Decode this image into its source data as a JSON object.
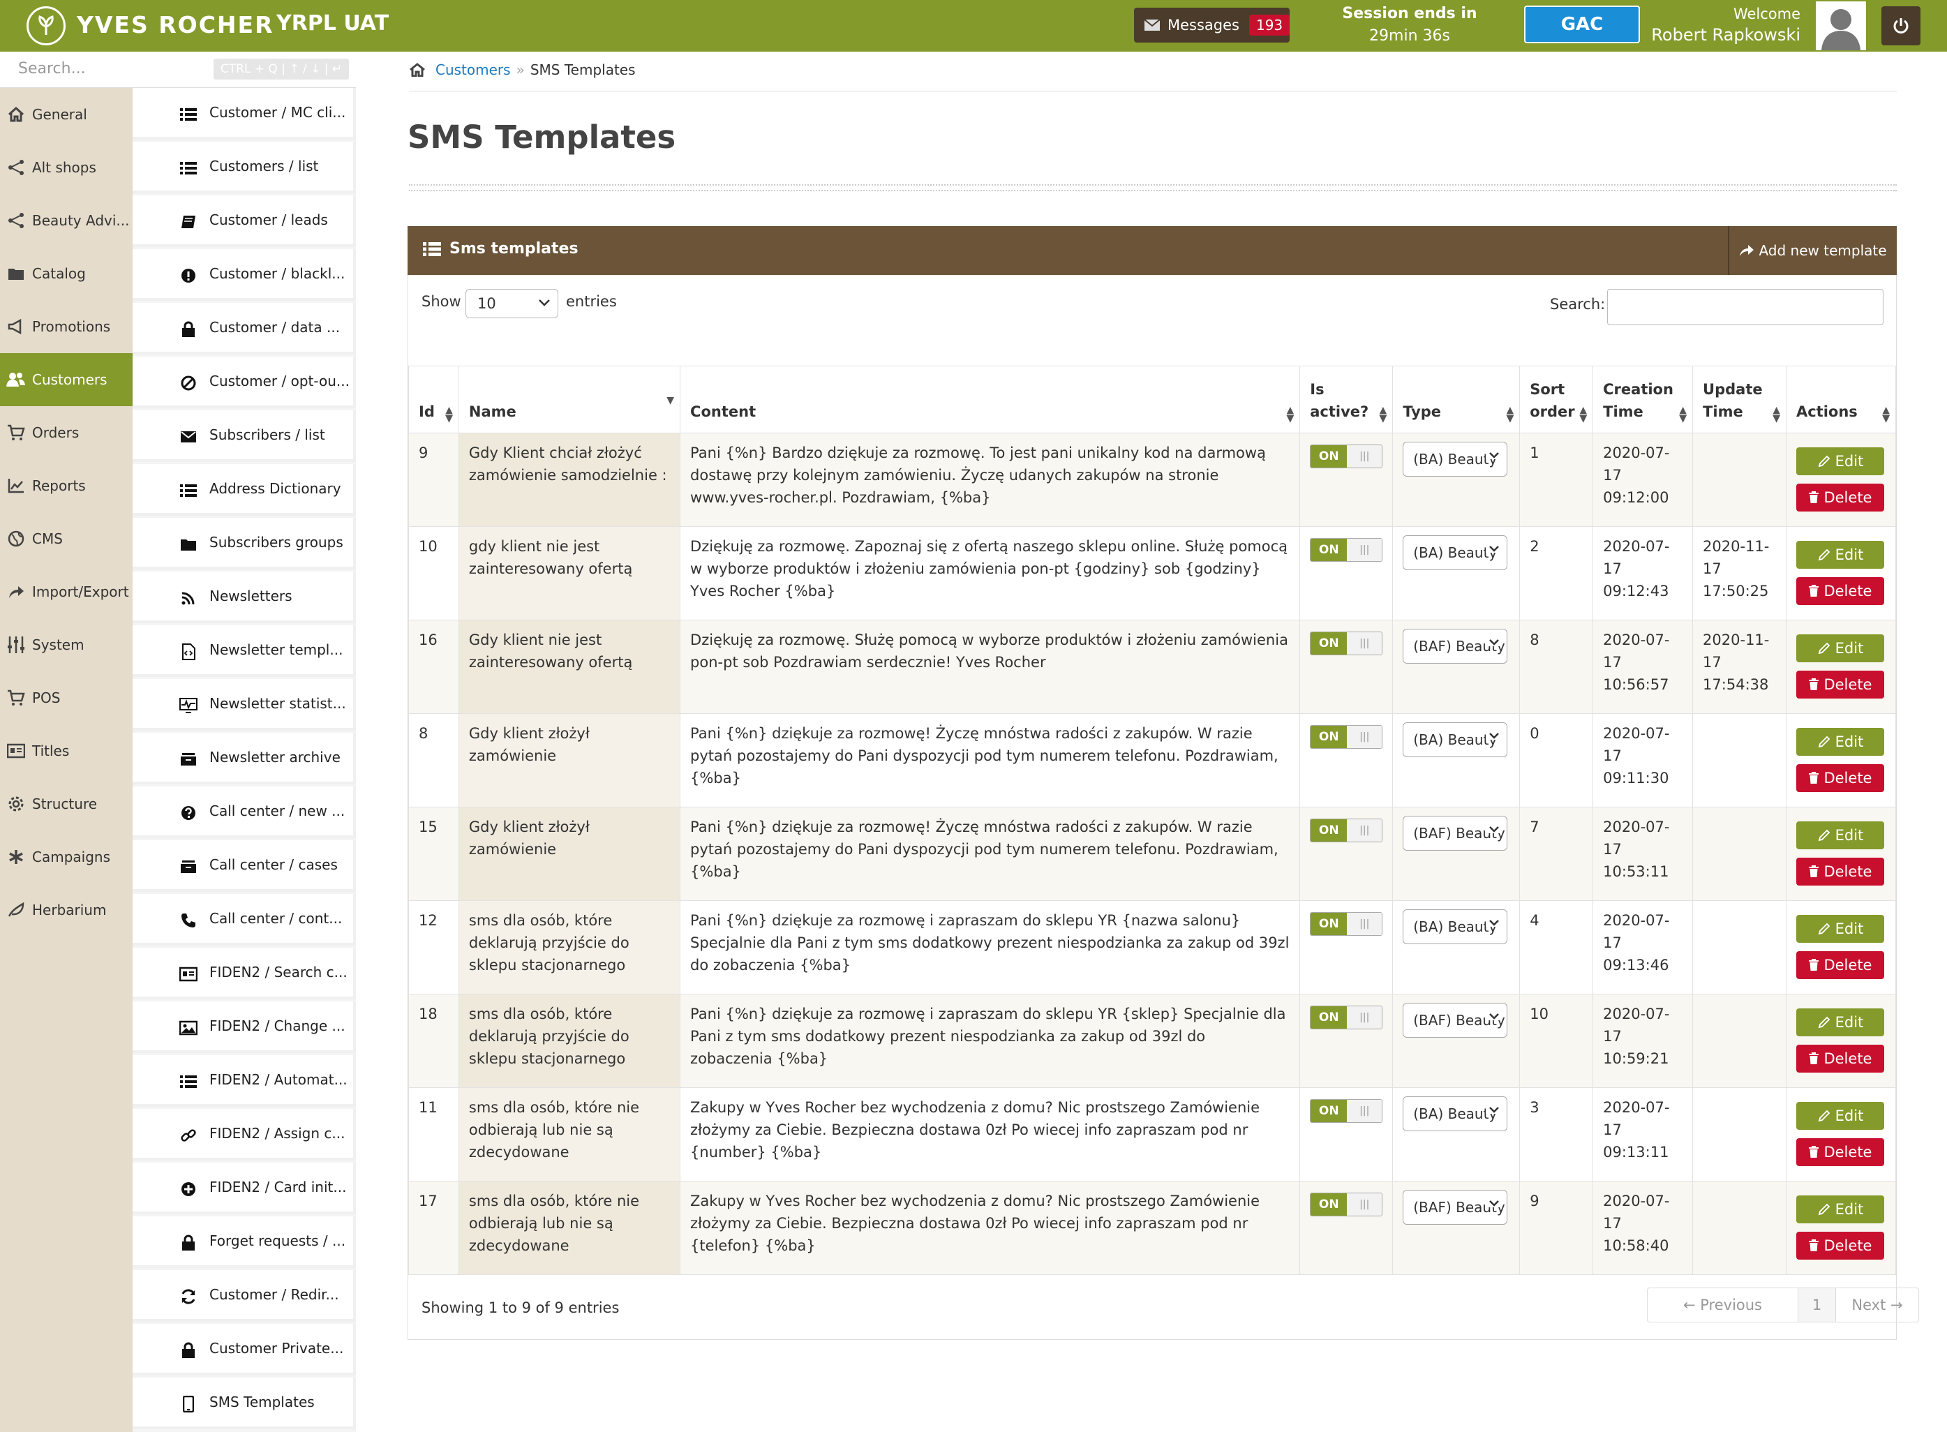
{
  "header": {
    "brand": "YVES ROCHER",
    "env": "YRPL UAT",
    "messages_label": "Messages",
    "messages_count": "193",
    "session_label": "Session ends in",
    "session_time": "29min 36s",
    "gac_label": "GAC",
    "welcome_label": "Welcome",
    "user_name": "Robert Rapkowski"
  },
  "sidebar": {
    "search_placeholder": "Search...",
    "search_hint": "CTRL + Q | ↑ / ↓ | ↵",
    "main_items": [
      {
        "label": "General",
        "icon": "home-icon"
      },
      {
        "label": "Alt shops",
        "icon": "share-icon"
      },
      {
        "label": "Beauty Advi...",
        "icon": "share-icon"
      },
      {
        "label": "Catalog",
        "icon": "folder-icon"
      },
      {
        "label": "Promotions",
        "icon": "bullhorn-icon"
      },
      {
        "label": "Customers",
        "icon": "users-icon"
      },
      {
        "label": "Orders",
        "icon": "cart-icon"
      },
      {
        "label": "Reports",
        "icon": "chart-icon"
      },
      {
        "label": "CMS",
        "icon": "globe-icon"
      },
      {
        "label": "Import/Export",
        "icon": "share-arrow-icon"
      },
      {
        "label": "System",
        "icon": "sliders-icon"
      },
      {
        "label": "POS",
        "icon": "cart-icon"
      },
      {
        "label": "Titles",
        "icon": "id-card-icon"
      },
      {
        "label": "Structure",
        "icon": "gear-icon"
      },
      {
        "label": "Campaigns",
        "icon": "asterisk-icon"
      },
      {
        "label": "Herbarium",
        "icon": "leaf-icon"
      }
    ],
    "sub_items": [
      {
        "label": "Customer / MC cli...",
        "icon": "list-icon"
      },
      {
        "label": "Customers / list",
        "icon": "list-icon"
      },
      {
        "label": "Customer / leads",
        "icon": "book-icon"
      },
      {
        "label": "Customer / blackl...",
        "icon": "exclamation-icon"
      },
      {
        "label": "Customer / data ...",
        "icon": "lock-icon"
      },
      {
        "label": "Customer / opt-ou...",
        "icon": "ban-icon"
      },
      {
        "label": "Subscribers / list",
        "icon": "envelope-icon"
      },
      {
        "label": "Address Dictionary",
        "icon": "list-icon"
      },
      {
        "label": "Subscribers groups",
        "icon": "folder-icon"
      },
      {
        "label": "Newsletters",
        "icon": "rss-icon"
      },
      {
        "label": "Newsletter templ...",
        "icon": "file-code-icon"
      },
      {
        "label": "Newsletter statist...",
        "icon": "heartbeat-icon"
      },
      {
        "label": "Newsletter archive",
        "icon": "inbox-icon"
      },
      {
        "label": "Call center / new ...",
        "icon": "question-icon"
      },
      {
        "label": "Call center / cases",
        "icon": "inbox-icon"
      },
      {
        "label": "Call center / cont...",
        "icon": "phone-icon"
      },
      {
        "label": "FIDEN2 / Search c...",
        "icon": "id-card-icon"
      },
      {
        "label": "FIDEN2 / Change ...",
        "icon": "image-icon"
      },
      {
        "label": "FIDEN2 / Automat...",
        "icon": "list-icon"
      },
      {
        "label": "FIDEN2 / Assign c...",
        "icon": "link-icon"
      },
      {
        "label": "FIDEN2 / Card init...",
        "icon": "plus-circle-icon"
      },
      {
        "label": "Forget requests / ...",
        "icon": "lock-icon"
      },
      {
        "label": "Customer / Redir...",
        "icon": "refresh-icon"
      },
      {
        "label": "Customer Private...",
        "icon": "lock-icon"
      },
      {
        "label": "SMS Templates",
        "icon": "mobile-icon"
      }
    ]
  },
  "breadcrumb": {
    "parent": "Customers",
    "sep": "»",
    "current": "SMS Templates"
  },
  "page": {
    "title": "SMS Templates"
  },
  "panel": {
    "title": "Sms templates",
    "add_label": "Add new template",
    "show_label": "Show",
    "page_size": "10",
    "entries_label": "entries",
    "search_label": "Search:",
    "showing_text": "Showing 1 to 9 of 9 entries",
    "pager": {
      "prev": "← Previous",
      "page": "1",
      "next": "Next →"
    }
  },
  "table": {
    "columns": {
      "id": "Id",
      "name": "Name",
      "content": "Content",
      "is_active_1": "Is",
      "is_active_2": "active?",
      "type": "Type",
      "sort_1": "Sort",
      "sort_2": "order",
      "creation_1": "Creation",
      "creation_2": "Time",
      "update_1": "Update",
      "update_2": "Time",
      "actions": "Actions"
    },
    "on_label": "ON",
    "edit_label": "Edit",
    "delete_label": "Delete",
    "rows": [
      {
        "id": "9",
        "name": "Gdy Klient chciał złożyć zamówienie samodzielnie :",
        "content": "Pani {%n} Bardzo dziękuje za rozmowę. To jest pani unikalny kod na darmową dostawę przy kolejnym zamówieniu. Życzę udanych zakupów na stronie www.yves-rocher.pl. Pozdrawiam, {%ba}",
        "type": "(BA) Beauty",
        "sort": "1",
        "created_date": "2020-07-17",
        "created_time": "09:12:00",
        "updated": ""
      },
      {
        "id": "10",
        "name": "gdy klient nie jest zainteresowany ofertą",
        "content": "Dziękuję za rozmowę. Zapoznaj się z ofertą naszego sklepu online. Służę pomocą w wyborze produktów i złożeniu zamówienia pon-pt {godziny} sob {godziny} Yves Rocher {%ba}",
        "type": "(BA) Beauty",
        "sort": "2",
        "created_date": "2020-07-17",
        "created_time": "09:12:43",
        "updated": "2020-11-17 17:50:25"
      },
      {
        "id": "16",
        "name": "Gdy klient nie jest zainteresowany ofertą",
        "content": "Dziękuję za rozmowę. Służę pomocą w wyborze produktów i złożeniu zamówienia pon-pt sob Pozdrawiam serdecznie! Yves Rocher",
        "type": "(BAF) Beauty",
        "sort": "8",
        "created_date": "2020-07-17",
        "created_time": "10:56:57",
        "updated": "2020-11-17 17:54:38"
      },
      {
        "id": "8",
        "name": "Gdy klient złożył zamówienie",
        "content": "Pani {%n} dziękuje za rozmowę! Życzę mnóstwa radości z zakupów. W razie pytań pozostajemy do Pani dyspozycji pod tym numerem telefonu. Pozdrawiam, {%ba}",
        "type": "(BA) Beauty",
        "sort": "0",
        "created_date": "2020-07-17",
        "created_time": "09:11:30",
        "updated": ""
      },
      {
        "id": "15",
        "name": "Gdy klient złożył zamówienie",
        "content": "Pani {%n} dziękuje za rozmowę! Życzę mnóstwa radości z zakupów. W razie pytań pozostajemy do Pani dyspozycji pod tym numerem telefonu. Pozdrawiam, {%ba}",
        "type": "(BAF) Beauty",
        "sort": "7",
        "created_date": "2020-07-17",
        "created_time": "10:53:11",
        "updated": ""
      },
      {
        "id": "12",
        "name": "sms dla osób, które deklarują przyjście do sklepu stacjonarnego",
        "content": "Pani {%n} dziękuje za rozmowę i zapraszam do sklepu YR {nazwa salonu} Specjalnie dla Pani z tym sms dodatkowy prezent niespodzianka za zakup od 39zl do zobaczenia {%ba}",
        "type": "(BA) Beauty",
        "sort": "4",
        "created_date": "2020-07-17",
        "created_time": "09:13:46",
        "updated": ""
      },
      {
        "id": "18",
        "name": "sms dla osób, które deklarują przyjście do sklepu stacjonarnego",
        "content": "Pani {%n} dziękuje za rozmowę i zapraszam do sklepu YR {sklep} Specjalnie dla Pani z tym sms dodatkowy prezent niespodzianka za zakup od 39zl do zobaczenia {%ba}",
        "type": "(BAF) Beauty",
        "sort": "10",
        "created_date": "2020-07-17",
        "created_time": "10:59:21",
        "updated": ""
      },
      {
        "id": "11",
        "name": "sms dla osób, które nie odbierają lub nie są zdecydowane",
        "content": "Zakupy w Yves Rocher bez wychodzenia z domu? Nic prostszego Zamówienie złożymy za Ciebie. Bezpieczna dostawa 0zł Po wiecej info zapraszam pod nr {number} {%ba}",
        "type": "(BA) Beauty",
        "sort": "3",
        "created_date": "2020-07-17",
        "created_time": "09:13:11",
        "updated": ""
      },
      {
        "id": "17",
        "name": "sms dla osób, które nie odbierają lub nie są zdecydowane",
        "content": "Zakupy w Yves Rocher bez wychodzenia z domu? Nic prostszego Zamówienie złożymy za Ciebie. Bezpieczna dostawa 0zł Po wiecej info zapraszam pod nr {telefon} {%ba}",
        "type": "(BAF) Beauty",
        "sort": "9",
        "created_date": "2020-07-17",
        "created_time": "10:58:40",
        "updated": ""
      }
    ]
  },
  "colors": {
    "brand_green": "#849a2b",
    "brown": "#6b5438",
    "danger": "#c8102e",
    "link": "#1a7ac0"
  }
}
